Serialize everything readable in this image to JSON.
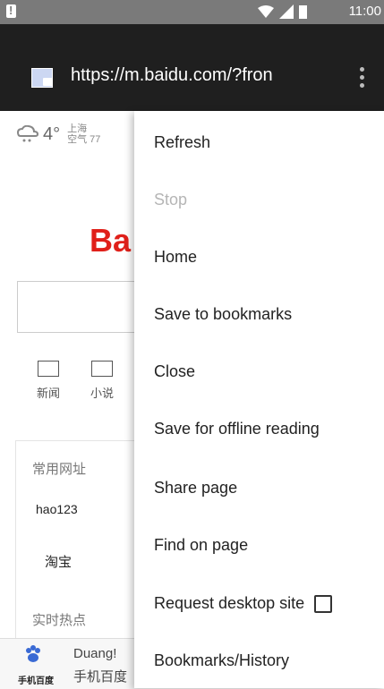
{
  "status_bar": {
    "time": "11:00",
    "icons": [
      "notification-icon",
      "wifi-icon",
      "signal-icon",
      "battery-icon"
    ]
  },
  "browser": {
    "url": "https://m.baidu.com/?fron"
  },
  "page": {
    "weather": {
      "temp": "4°",
      "city_line1": "上海",
      "city_line2": "空气 77"
    },
    "logo": "Ba",
    "nav": [
      {
        "label": "新闻"
      },
      {
        "label": "小说"
      }
    ],
    "favorites_title": "常用网址",
    "favorites": [
      "hao123",
      "淘宝"
    ],
    "hot_title": "实时热点",
    "footer": {
      "app_name": "手机百度",
      "line1": "Duang!",
      "line2": "手机百度"
    }
  },
  "menu": {
    "items": [
      {
        "label": "Refresh",
        "enabled": true
      },
      {
        "label": "Stop",
        "enabled": false
      },
      {
        "label": "Home",
        "enabled": true
      },
      {
        "label": "Save to bookmarks",
        "enabled": true
      },
      {
        "label": "Close",
        "enabled": true
      },
      {
        "label": "Save for offline reading",
        "enabled": true
      },
      {
        "label": "Share page",
        "enabled": true
      },
      {
        "label": "Find on page",
        "enabled": true
      },
      {
        "label": "Request desktop site",
        "enabled": true,
        "checked": false
      },
      {
        "label": "Bookmarks/History",
        "enabled": true
      }
    ]
  }
}
